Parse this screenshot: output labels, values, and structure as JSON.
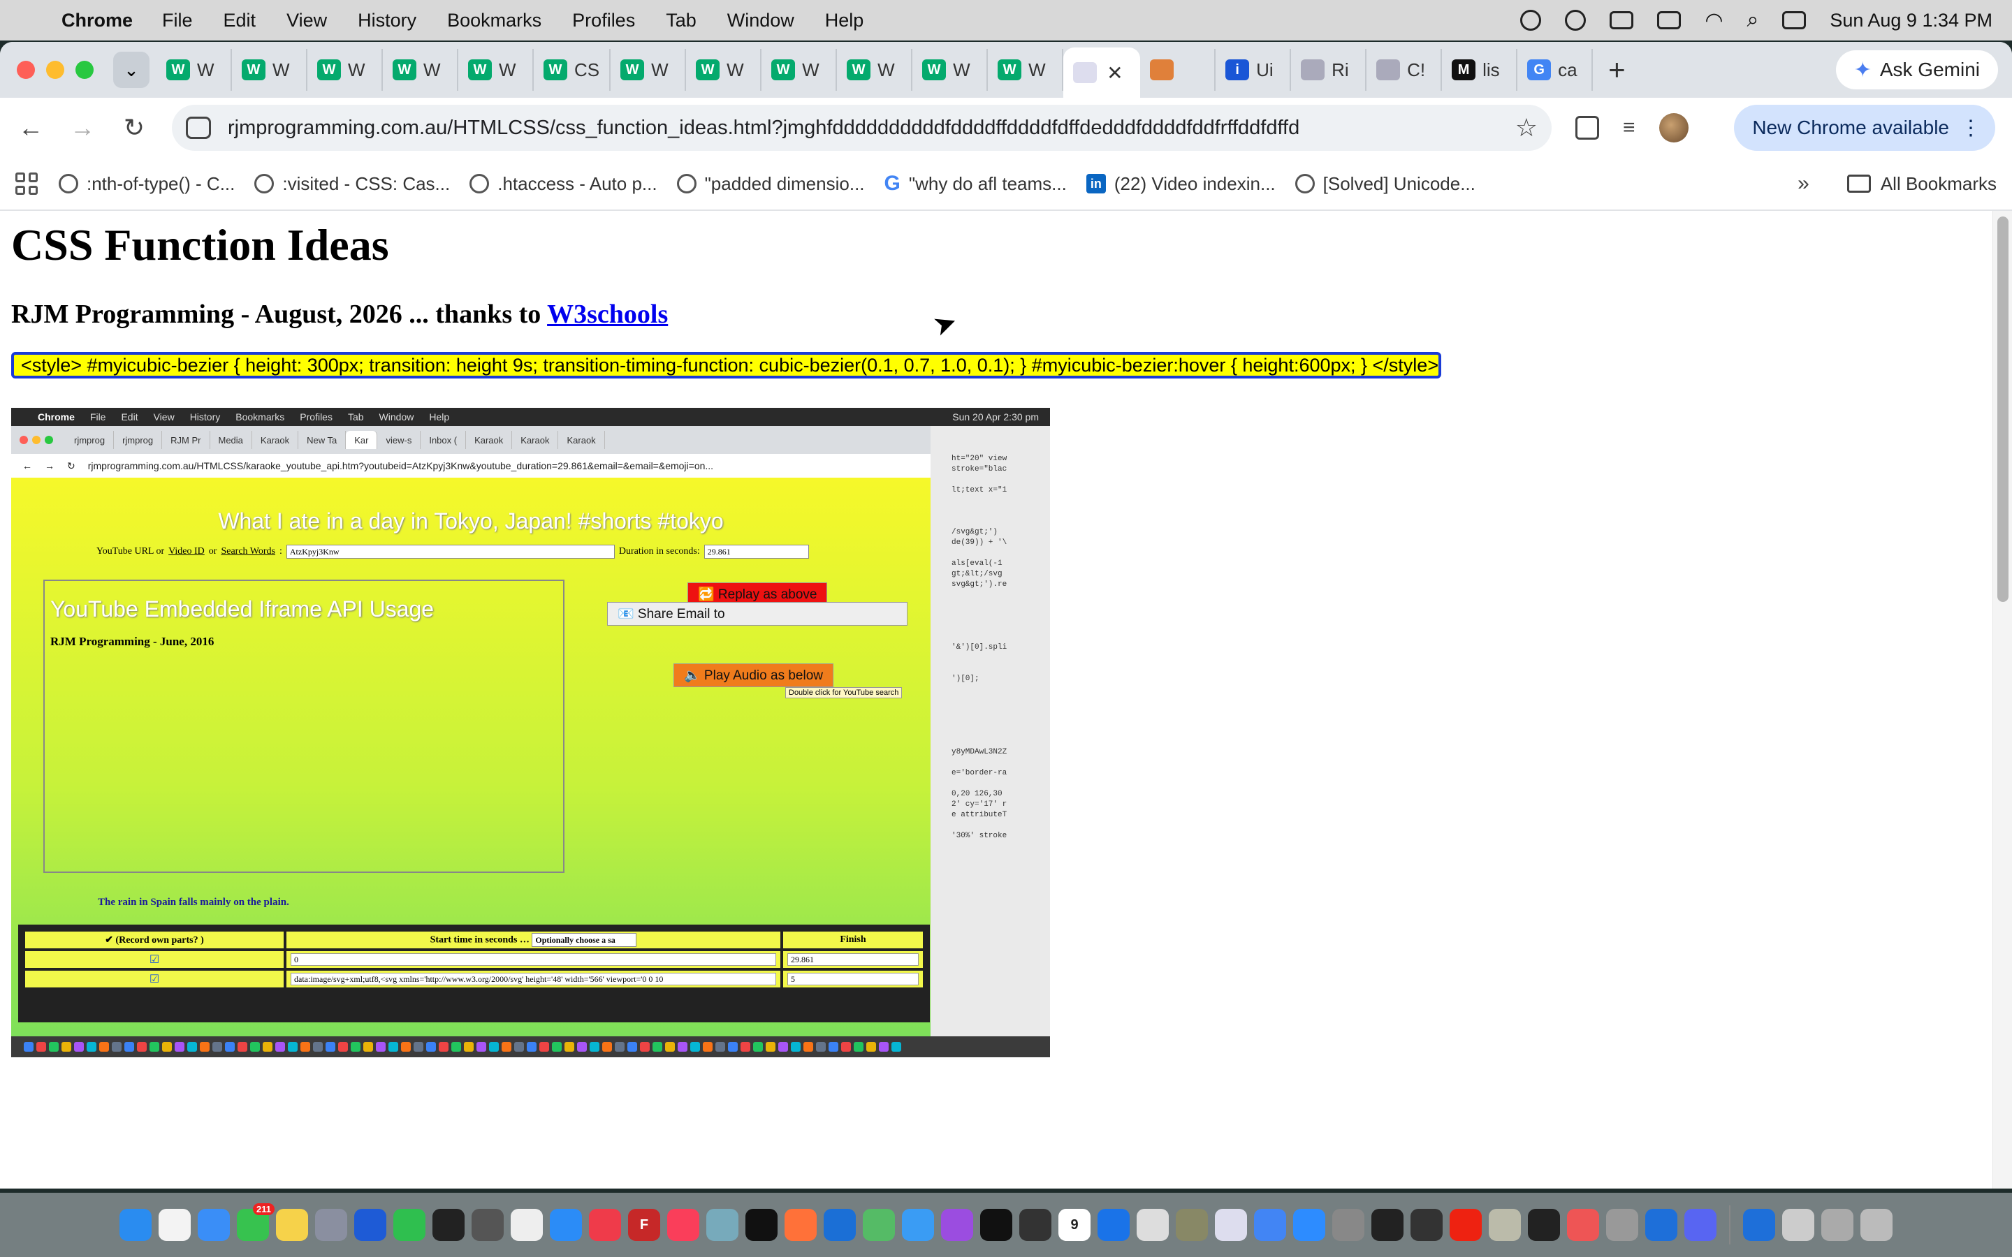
{
  "menubar": {
    "app_name": "Chrome",
    "items": [
      "File",
      "Edit",
      "View",
      "History",
      "Bookmarks",
      "Profiles",
      "Tab",
      "Window",
      "Help"
    ],
    "clock": "Sun Aug 9  1:34 PM"
  },
  "tabs": {
    "items": [
      {
        "icon": "w3schools-icon",
        "label": "W",
        "color": "#04aa6d"
      },
      {
        "icon": "w3schools-icon",
        "label": "W",
        "color": "#04aa6d"
      },
      {
        "icon": "w3schools-icon",
        "label": "W",
        "color": "#04aa6d"
      },
      {
        "icon": "w3schools-icon",
        "label": "W",
        "color": "#04aa6d"
      },
      {
        "icon": "w3schools-icon",
        "label": "W",
        "color": "#04aa6d"
      },
      {
        "icon": "w3schools-icon",
        "label": "CS",
        "color": "#04aa6d"
      },
      {
        "icon": "w3schools-icon",
        "label": "W",
        "color": "#04aa6d"
      },
      {
        "icon": "w3schools-icon",
        "label": "W",
        "color": "#04aa6d"
      },
      {
        "icon": "w3schools-icon",
        "label": "W",
        "color": "#04aa6d"
      },
      {
        "icon": "w3schools-icon",
        "label": "W",
        "color": "#04aa6d"
      },
      {
        "icon": "w3schools-icon",
        "label": "W",
        "color": "#04aa6d"
      },
      {
        "icon": "w3schools-icon",
        "label": "W",
        "color": "#04aa6d"
      }
    ],
    "active": {
      "icon": "rjm-icon"
    },
    "after": [
      {
        "icon": "image-icon",
        "label": "",
        "color": "#e0803a"
      },
      {
        "icon": "info-icon",
        "label": "Ui",
        "color": "#1a56d6"
      },
      {
        "icon": "rjm-icon",
        "label": "Ri",
        "color": "#aab"
      },
      {
        "icon": "rjm-icon",
        "label": "C!",
        "color": "#aab"
      },
      {
        "icon": "medium-icon",
        "label": "lis",
        "color": "#111"
      },
      {
        "icon": "google-icon",
        "label": "ca",
        "color": "#4285f4"
      }
    ],
    "ask_gemini": "Ask Gemini"
  },
  "toolbar": {
    "url": "rjmprogramming.com.au/HTMLCSS/css_function_ideas.html?jmghfddddddddddfddddffddddfdffdedddfddddfddfrffddfdffd",
    "new_chrome": "New Chrome available"
  },
  "bookmarks": {
    "items": [
      {
        "icon": "globe-icon",
        "label": ":nth-of-type() - C..."
      },
      {
        "icon": "globe-icon",
        "label": ":visited - CSS: Cas..."
      },
      {
        "icon": "globe-icon",
        "label": ".htaccess - Auto p..."
      },
      {
        "icon": "globe-icon",
        "label": "\"padded dimensio..."
      },
      {
        "icon": "google-icon",
        "label": "\"why do afl teams..."
      },
      {
        "icon": "linkedin-icon",
        "label": "(22) Video indexin..."
      },
      {
        "icon": "globe-icon",
        "label": "[Solved] Unicode..."
      }
    ],
    "more": "»",
    "all": "All Bookmarks"
  },
  "page": {
    "title": "CSS Function Ideas",
    "subtitle_prefix": "RJM Programming - August, 2026 ... thanks to ",
    "subtitle_link": "W3schools",
    "style_select_value": "<style> #myicubic-bezier { height: 300px; transition: height 9s; transition-timing-function: cubic-bezier(0.1, 0.7, 1.0, 0.1); } #myicubic-bezier:hover { height:600px; } </style>"
  },
  "shot": {
    "menubar_app": "Chrome",
    "menubar_items": [
      "File",
      "Edit",
      "View",
      "History",
      "Bookmarks",
      "Profiles",
      "Tab",
      "Window",
      "Help"
    ],
    "menubar_clock": "Sun 20 Apr  2:30 pm",
    "tabs": [
      "rjmprog",
      "rjmprog",
      "RJM Pr",
      "Media",
      "Karaok",
      "New Ta",
      "Kar",
      "view-s",
      "Inbox (",
      "Karaok",
      "Karaok",
      "Karaok"
    ],
    "url": "rjmprogramming.com.au/HTMLCSS/karaoke_youtube_api.htm?youtubeid=AtzKpyj3Knw&youtube_duration=29.861&email=&email=&emoji=on...",
    "heading": "What I ate in a day in Tokyo, Japan! #shorts #tokyo",
    "yt_label_a": "YouTube URL or ",
    "yt_label_b": "Video ID",
    "yt_label_c": " or ",
    "yt_label_d": "Search Words",
    "yt_value": "AtzKpyj3Knw",
    "duration_label": "Duration in seconds:",
    "duration_value": "29.861",
    "frame_title": "YouTube Embedded Iframe API Usage",
    "frame_sub": "RJM Programming - June, 2016",
    "replay": "🔁 Replay as above",
    "share": "📧 Share Email to",
    "play": "🔈 Play Audio as below",
    "tip": "Double click for YouTube search",
    "rain": "The rain in Spain falls mainly on the plain.",
    "th_record": "✔ (Record own parts?    )",
    "th_start": "Start time in seconds",
    "th_select": "Optionally choose a sa",
    "th_finish": "Finish",
    "row1_start": "0",
    "row1_finish": "29.861",
    "row2_start": "data:image/svg+xml;utf8,<svg xmlns='http://www.w3.org/2000/svg' height='48' width='566' viewport='0 0 10",
    "row2_finish": "5",
    "side_code": "ht=\"20\" view\nstroke=\"blac\n\nlt;text x=\"1\n\n\n\n/svg&gt;')\nde(39)) + '\\\n\nals[eval(-1\ngt;&lt;/svg\nsvg&gt;').re\n\n\n\n\n\n'&')[0].spli\n\n\n')[0];\n\n\n\n\n\n\ny8yMDAwL3N2Z\n\ne='border-ra\n\n0,20 126,30\n2' cy='17' r\ne attributeT\n\n'30%' stroke"
  },
  "dock": {
    "badges": {
      "calendar": "9",
      "mail": "211"
    }
  }
}
